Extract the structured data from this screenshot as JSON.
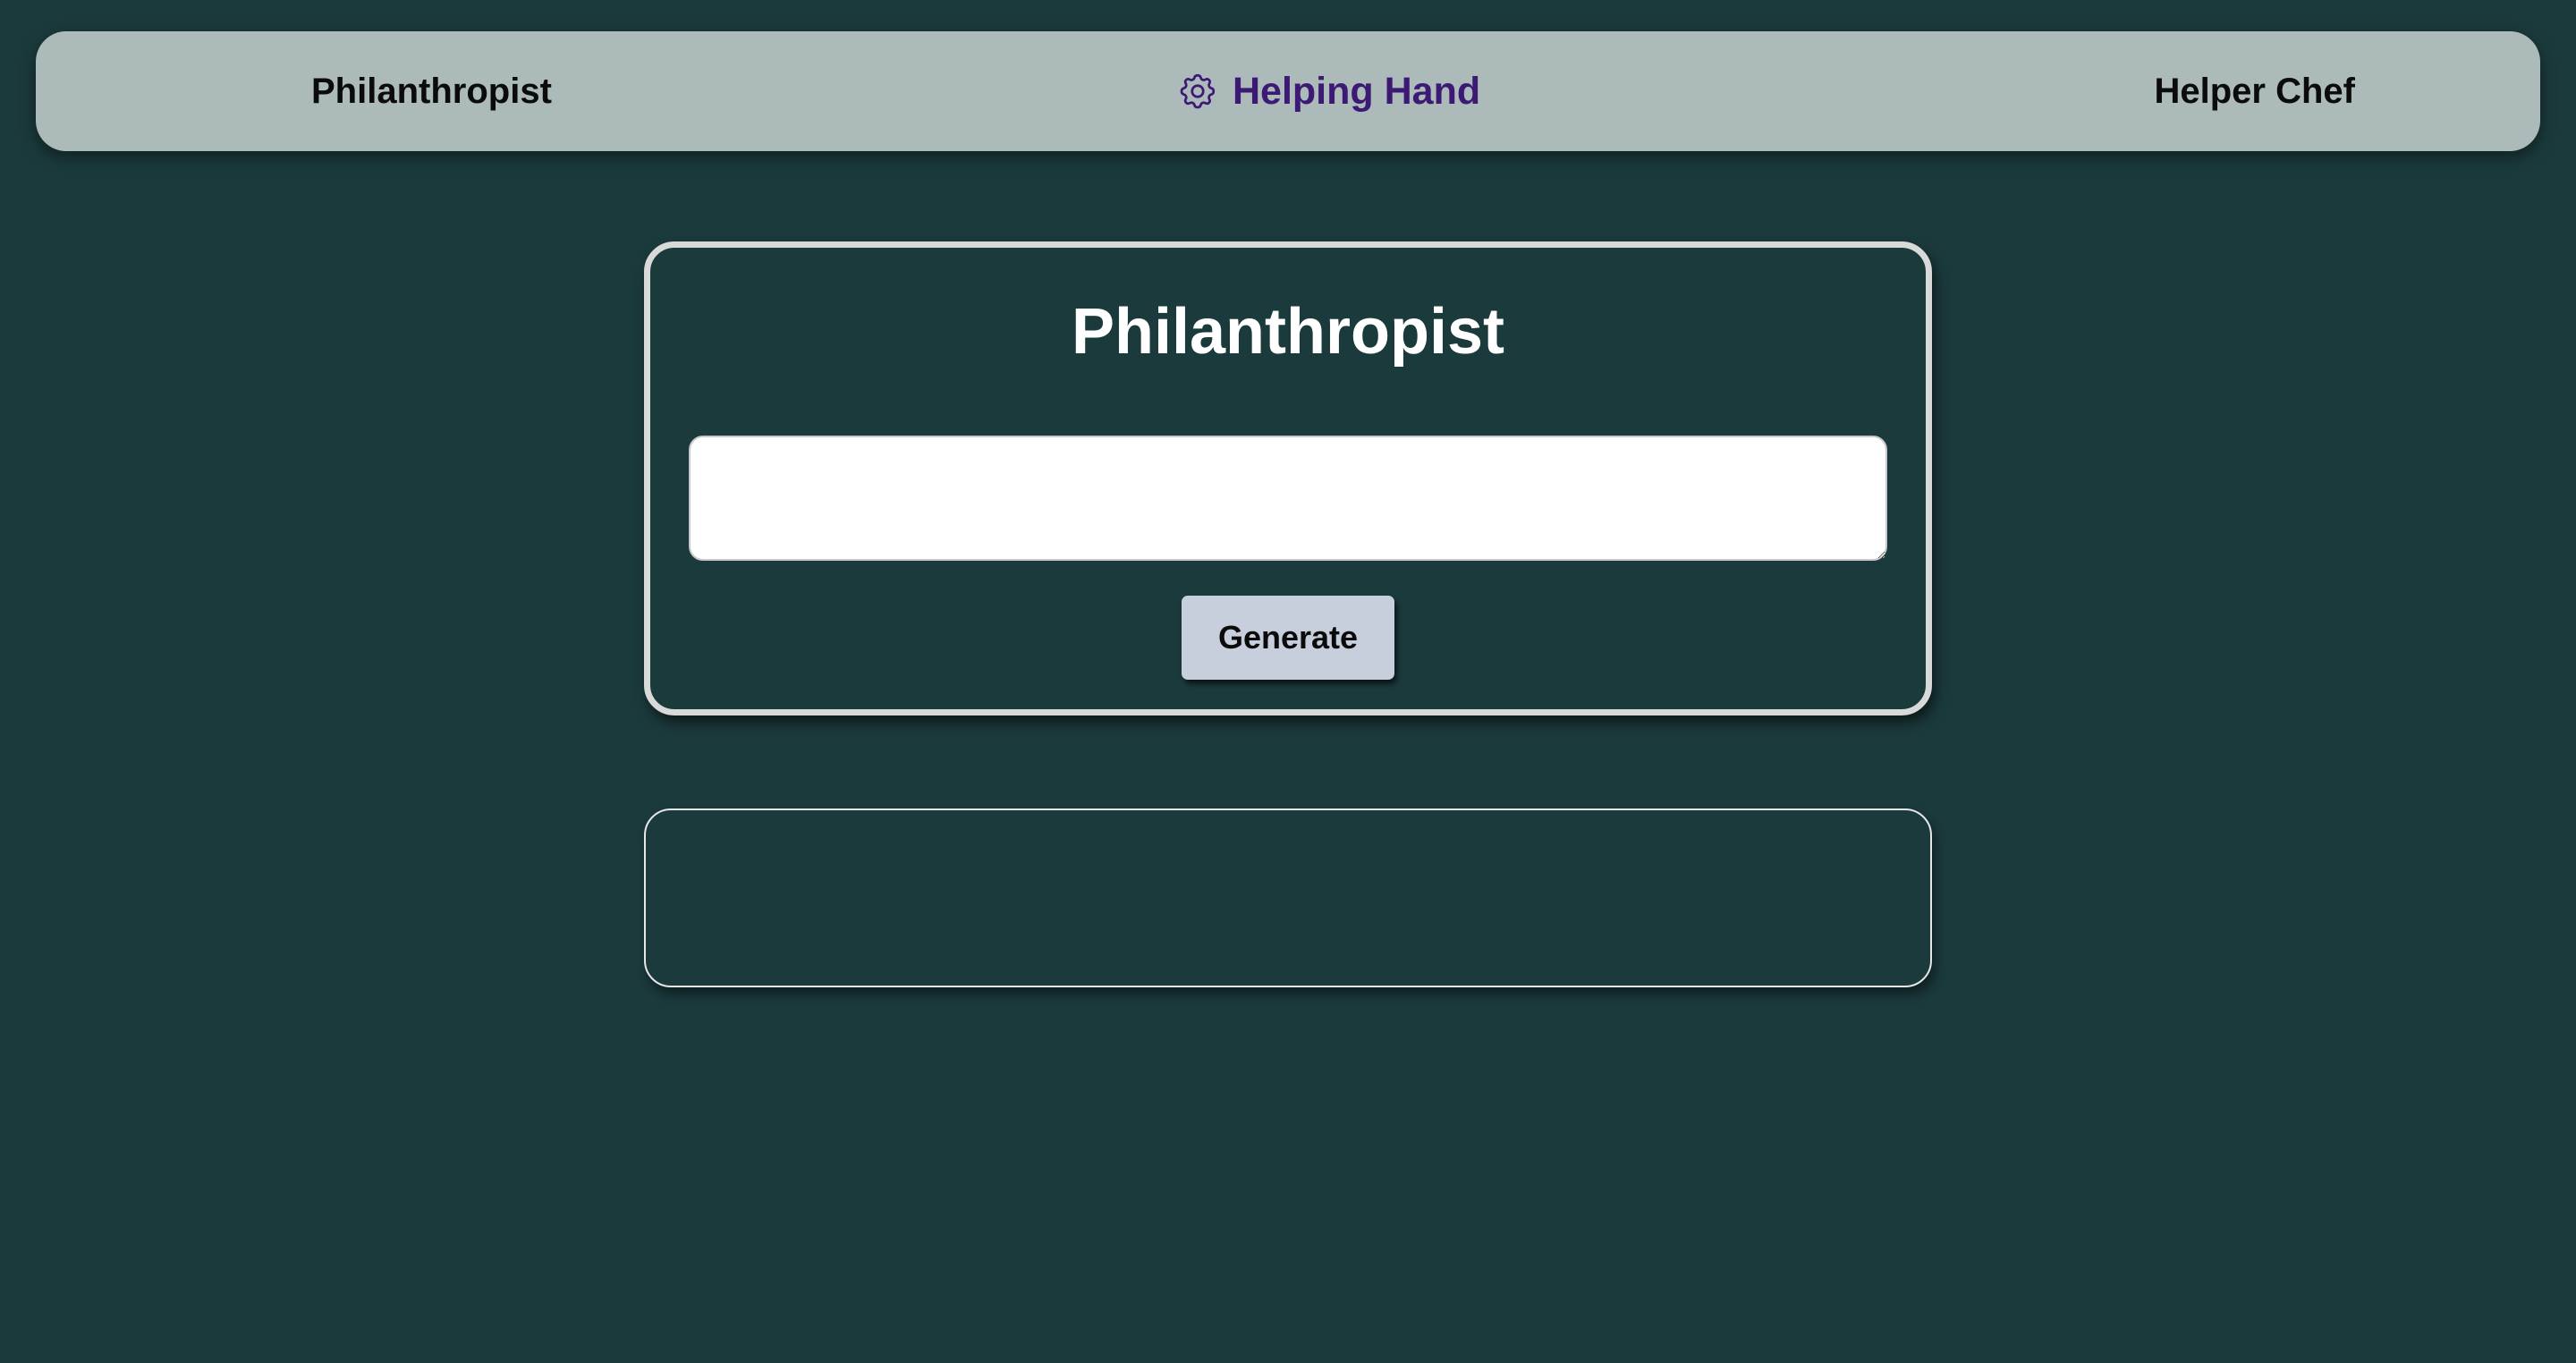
{
  "navbar": {
    "left_link": "Philanthropist",
    "brand": {
      "icon": "gear-icon",
      "label": "Helping Hand"
    },
    "right_link": "Helper Chef"
  },
  "main": {
    "title": "Philanthropist",
    "prompt_input": {
      "value": "",
      "placeholder": ""
    },
    "generate_label": "Generate",
    "output_text": ""
  },
  "colors": {
    "background": "#1b3a3c",
    "navbar": "#adbaba",
    "brand": "#3c1a74",
    "button": "#c6cfdb",
    "card_border": "#d9d9d9"
  }
}
